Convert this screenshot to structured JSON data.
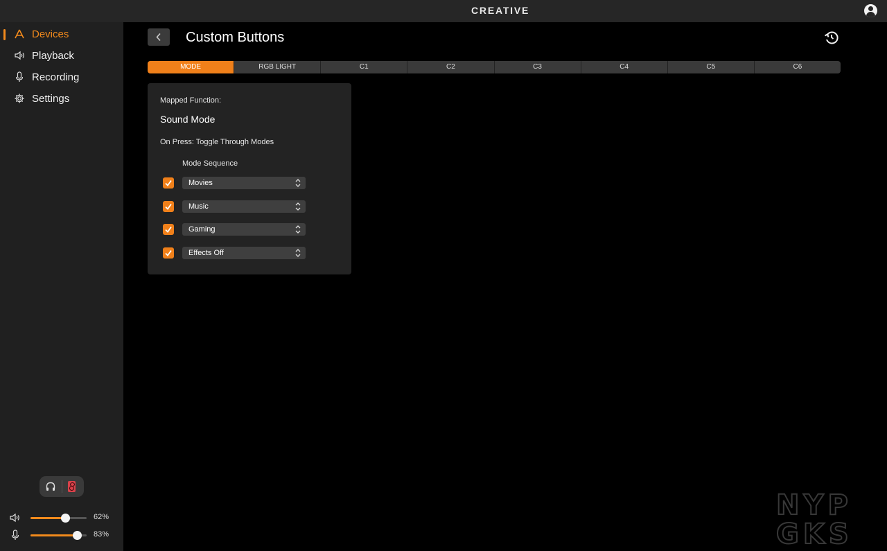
{
  "app": {
    "brand": "CREATIVE"
  },
  "sidebar": {
    "items": [
      {
        "label": "Devices",
        "icon": "creative-logo-icon",
        "active": true
      },
      {
        "label": "Playback",
        "icon": "speaker-icon",
        "active": false
      },
      {
        "label": "Recording",
        "icon": "microphone-icon",
        "active": false
      },
      {
        "label": "Settings",
        "icon": "gear-icon",
        "active": false
      }
    ],
    "output_toggle": {
      "options": [
        "headphones-icon",
        "speaker-box-icon"
      ],
      "selected": "speaker-box-icon"
    },
    "volume": {
      "icon": "speaker-icon",
      "value": 62,
      "label": "62%"
    },
    "mic": {
      "icon": "microphone-icon",
      "value": 83,
      "label": "83%"
    }
  },
  "main": {
    "title": "Custom Buttons",
    "tabs": [
      {
        "label": "MODE",
        "active": true
      },
      {
        "label": "RGB LIGHT",
        "active": false
      },
      {
        "label": "C1",
        "active": false
      },
      {
        "label": "C2",
        "active": false
      },
      {
        "label": "C3",
        "active": false
      },
      {
        "label": "C4",
        "active": false
      },
      {
        "label": "C5",
        "active": false
      },
      {
        "label": "C6",
        "active": false
      }
    ],
    "card": {
      "mapped_function_label": "Mapped Function:",
      "mapped_function_value": "Sound Mode",
      "on_press": "On Press: Toggle Through Modes",
      "sequence_label": "Mode Sequence",
      "sequence": [
        {
          "value": "Movies",
          "checked": true
        },
        {
          "value": "Music",
          "checked": true
        },
        {
          "value": "Gaming",
          "checked": true
        },
        {
          "value": "Effects Off",
          "checked": true
        }
      ]
    }
  },
  "watermark": {
    "line1": "NYP",
    "line2": "GKS"
  },
  "colors": {
    "accent": "#f0801a",
    "sidebar": "#202020",
    "card": "#232323",
    "titlebar": "#262626"
  }
}
